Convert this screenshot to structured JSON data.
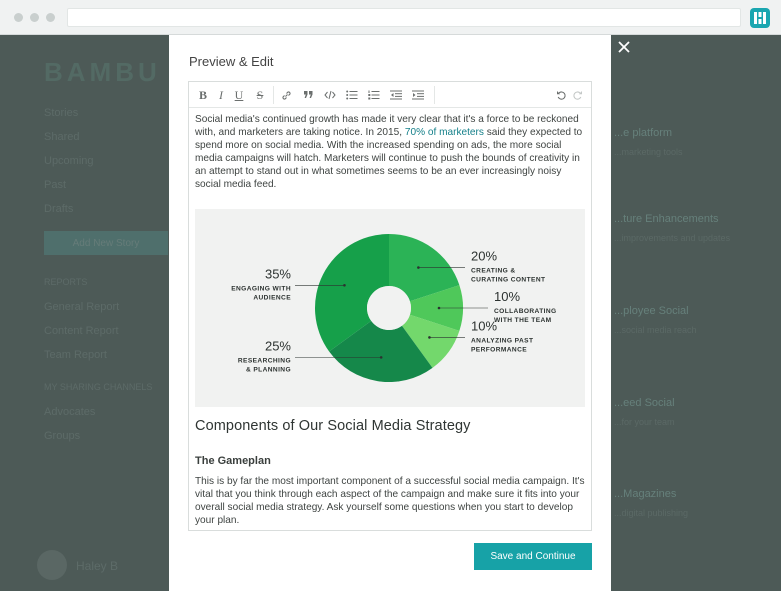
{
  "background_app": {
    "logo": "BAMBU",
    "nav_items": [
      "Stories",
      "Shared",
      "Upcoming",
      "Past",
      "Drafts"
    ],
    "new_story_button": "Add New Story",
    "reports_header": "REPORTS",
    "report_items": [
      "General Report",
      "Content Report",
      "Team Report"
    ],
    "channels_header": "MY SHARING CHANNELS",
    "channel_items": [
      "Advocates",
      "Groups"
    ],
    "user_name": "Haley B",
    "right_cards": [
      {
        "title": "...e platform",
        "sub": "...marketing tools"
      },
      {
        "title": "...ture Enhancements",
        "sub": "...improvements and updates"
      },
      {
        "title": "...ployee Social",
        "sub": "...social media reach"
      },
      {
        "title": "...eed Social",
        "sub": "...for your team"
      },
      {
        "title": "...Magazines",
        "sub": "...digital publishing"
      }
    ]
  },
  "modal": {
    "title": "Preview & Edit",
    "close_icon": "close-icon",
    "toolbar": {
      "bold": "B",
      "italic": "I",
      "underline": "U",
      "strike": "S"
    },
    "intro": {
      "before_link": "Social media's continued growth has made it very clear that it's a force to be reckoned with, and marketers are taking notice. In 2015, ",
      "link": "70% of marketers",
      "after_link": " said they expected to spend more on social media. With the increased spending on ads, the more social media campaigns will hatch. Marketers will continue to push the bounds of creativity in an attempt to stand out in what sometimes seems to be an ever increasingly noisy social media feed."
    },
    "heading": "Components of Our Social Media Strategy",
    "subheading": "The Gameplan",
    "body": "This is by far the most important component of a successful social media campaign. It's vital that you think through each aspect of the campaign and make sure it fits into your overall social media strategy. Ask yourself some questions when you start to develop your plan.",
    "save_button": "Save and Continue"
  },
  "chart_data": {
    "type": "pie",
    "donut": true,
    "slices": [
      {
        "label_lines": [
          "CREATING &",
          "CURATING CONTENT"
        ],
        "value": 20,
        "value_label": "20%",
        "color": "#2bb356"
      },
      {
        "label_lines": [
          "COLLABORATING",
          "WITH THE TEAM"
        ],
        "value": 10,
        "value_label": "10%",
        "color": "#4fc85a"
      },
      {
        "label_lines": [
          "ANALYZING PAST",
          "PERFORMANCE"
        ],
        "value": 10,
        "value_label": "10%",
        "color": "#73d86c"
      },
      {
        "label_lines": [
          "RESEARCHING",
          "& PLANNING"
        ],
        "value": 25,
        "value_label": "25%",
        "color": "#15884a"
      },
      {
        "label_lines": [
          "ENGAGING WITH",
          "AUDIENCE"
        ],
        "value": 35,
        "value_label": "35%",
        "color": "#16a04a"
      }
    ]
  }
}
